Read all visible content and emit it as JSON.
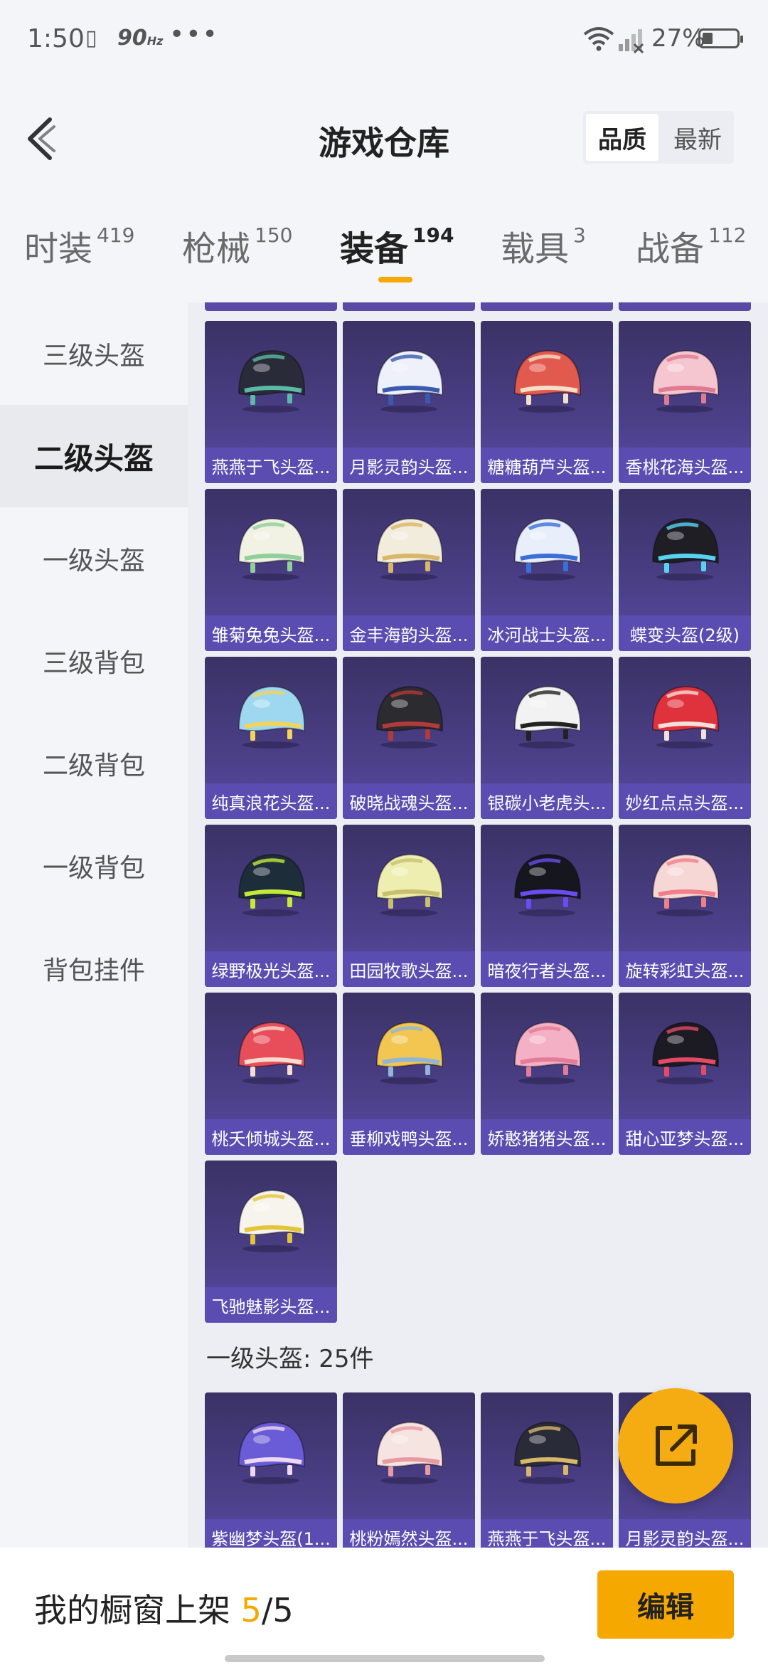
{
  "status_bar": {
    "time": "1:50",
    "refresh_rate": "90",
    "refresh_unit": "Hz",
    "battery": "27%"
  },
  "header": {
    "title": "游戏仓库",
    "sort_options": [
      "品质",
      "最新"
    ],
    "sort_selected": "品质"
  },
  "tabs": [
    {
      "label": "时装",
      "count": "419"
    },
    {
      "label": "枪械",
      "count": "150"
    },
    {
      "label": "装备",
      "count": "194",
      "active": true
    },
    {
      "label": "载具",
      "count": "3"
    },
    {
      "label": "战备",
      "count": "112"
    }
  ],
  "sidebar": {
    "items": [
      "三级头盔",
      "二级头盔",
      "一级头盔",
      "三级背包",
      "二级背包",
      "一级背包",
      "背包挂件"
    ],
    "active": "二级头盔"
  },
  "grid": {
    "items": [
      {
        "name": "燕燕于飞头盔...",
        "color": "#2a2b38",
        "accent": "#5bb9a8"
      },
      {
        "name": "月影灵韵头盔...",
        "color": "#eef0fa",
        "accent": "#3a5ab0"
      },
      {
        "name": "糖糖葫芦头盔...",
        "color": "#e25a4e",
        "accent": "#f4e0c8"
      },
      {
        "name": "香桃花海头盔...",
        "color": "#f6c6d0",
        "accent": "#e07a92"
      },
      {
        "name": "雏菊兔兔头盔...",
        "color": "#f1f1e4",
        "accent": "#8fcf9a"
      },
      {
        "name": "金丰海韵头盔...",
        "color": "#f2ecdc",
        "accent": "#d8b66a"
      },
      {
        "name": "冰河战士头盔...",
        "color": "#e8eefa",
        "accent": "#3a6fd8"
      },
      {
        "name": "蝶变头盔(2级)",
        "color": "#1e1e24",
        "accent": "#57d2f0"
      },
      {
        "name": "纯真浪花头盔...",
        "color": "#9ed8f0",
        "accent": "#f3d35a"
      },
      {
        "name": "破晓战魂头盔...",
        "color": "#2b2b30",
        "accent": "#b23a3a"
      },
      {
        "name": "银碳小老虎头...",
        "color": "#f2f2f2",
        "accent": "#222222"
      },
      {
        "name": "妙红点点头盔...",
        "color": "#e0323c",
        "accent": "#f3e0d8"
      },
      {
        "name": "绿野极光头盔...",
        "color": "#1d2e3a",
        "accent": "#c5e83a"
      },
      {
        "name": "田园牧歌头盔...",
        "color": "#eeeeb0",
        "accent": "#c8c070"
      },
      {
        "name": "暗夜行者头盔...",
        "color": "#16161e",
        "accent": "#6a4cf0"
      },
      {
        "name": "旋转彩虹头盔...",
        "color": "#f7d6d6",
        "accent": "#f07f8a"
      },
      {
        "name": "桃夭倾城头盔...",
        "color": "#e84e5a",
        "accent": "#f7dcd0"
      },
      {
        "name": "垂柳戏鸭头盔...",
        "color": "#f2c650",
        "accent": "#8fb6d8"
      },
      {
        "name": "娇憨猪猪头盔...",
        "color": "#f4b0c4",
        "accent": "#e27c98"
      },
      {
        "name": "甜心亚梦头盔...",
        "color": "#1c1a22",
        "accent": "#e24a66"
      },
      {
        "name": "飞驰魅影头盔...",
        "color": "#f6f4ec",
        "accent": "#e6c43a"
      }
    ]
  },
  "section": {
    "title": "一级头盔: 25件"
  },
  "grid2": {
    "items": [
      {
        "name": "紫幽梦头盔(1...",
        "color": "#6a5cd6",
        "accent": "#f0d8f0"
      },
      {
        "name": "桃粉嫣然头盔...",
        "color": "#f6e4e0",
        "accent": "#e89aa4"
      },
      {
        "name": "燕燕于飞头盔...",
        "color": "#2a2b38",
        "accent": "#d8b66a"
      },
      {
        "name": "月影灵韵头盔...",
        "color": "#eef0fa",
        "accent": "#3a5ab0"
      }
    ]
  },
  "bottom_bar": {
    "label": "我的橱窗上架 ",
    "current": "5",
    "separator": "/",
    "total": "5",
    "edit_button": "编辑"
  }
}
